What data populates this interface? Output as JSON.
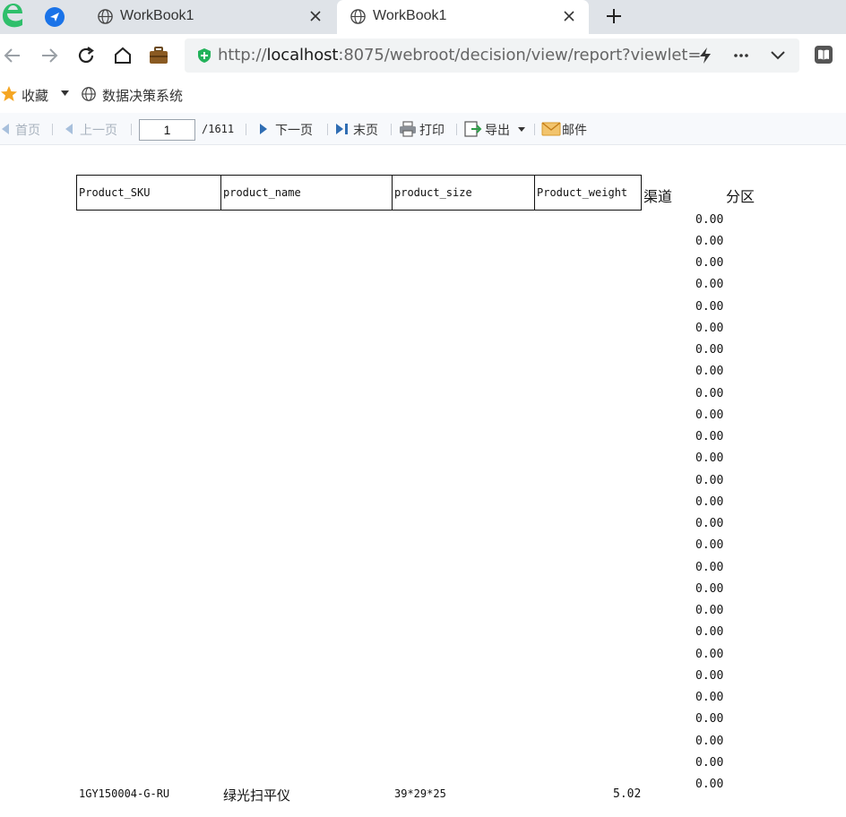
{
  "browser": {
    "tabs": [
      {
        "title": "WorkBook1",
        "active": false
      },
      {
        "title": "WorkBook1",
        "active": true
      }
    ],
    "url_prefix": "http://",
    "url_host": "localhost",
    "url_rest": ":8075/webroot/decision/view/report?viewlet="
  },
  "bookmarks": {
    "favorites_label": "收藏",
    "system_label": "数据决策系统"
  },
  "toolbar": {
    "first": "首页",
    "prev": "上一页",
    "page_value": "1",
    "page_total": "/1611",
    "next": "下一页",
    "last": "末页",
    "print": "打印",
    "export": "导出",
    "mail": "邮件"
  },
  "report": {
    "headers": [
      "Product_SKU",
      "product_name",
      "product_size",
      "Product_weight"
    ],
    "extra_headers": [
      "渠道",
      "分区"
    ],
    "zero_values": [
      "0.00",
      "0.00",
      "0.00",
      "0.00",
      "0.00",
      "0.00",
      "0.00",
      "0.00",
      "0.00",
      "0.00",
      "0.00",
      "0.00",
      "0.00",
      "0.00",
      "0.00",
      "0.00",
      "0.00",
      "0.00",
      "0.00",
      "0.00",
      "0.00",
      "0.00",
      "0.00",
      "0.00",
      "0.00",
      "0.00",
      "0.00"
    ],
    "data_row": {
      "sku": "1GY150004-G-RU",
      "name": "绿光扫平仪",
      "size": "39*29*25",
      "weight": "5.02"
    }
  },
  "colors": {
    "accent_blue": "#1a73e8",
    "shield_green": "#22b25a",
    "browser_logo_green": "#2fbf6b"
  }
}
